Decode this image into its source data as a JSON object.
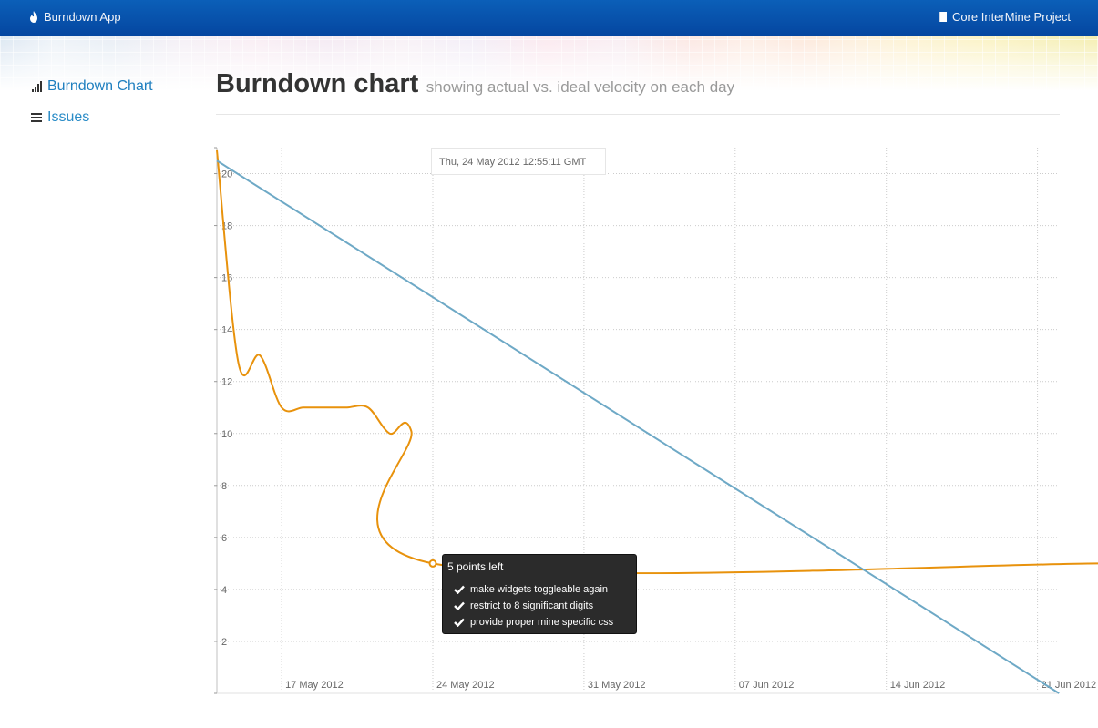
{
  "navbar": {
    "brand_label": "Burndown App",
    "brand_icon": "flame-icon",
    "project_label": "Core InterMine Project",
    "project_icon": "book-icon",
    "color": "#0546a0"
  },
  "sidebar": {
    "items": [
      {
        "label": "Burndown Chart",
        "icon": "bar-chart-icon",
        "active": true
      },
      {
        "label": "Issues",
        "icon": "list-icon",
        "active": false
      }
    ]
  },
  "header": {
    "title": "Burndown chart",
    "subtitle": "showing actual vs. ideal velocity on each day"
  },
  "hover_label": "Thu, 24 May 2012 12:55:11 GMT",
  "tooltip": {
    "title": "5 points left",
    "items": [
      "make widgets toggleable again",
      "restrict to 8 significant digits",
      "provide proper mine specific css"
    ]
  },
  "chart_data": {
    "type": "line",
    "title": "",
    "xlabel": "",
    "ylabel": "",
    "x_ticks": [
      "17 May 2012",
      "24 May 2012",
      "31 May 2012",
      "07 Jun 2012",
      "14 Jun 2012",
      "21 Jun 2012"
    ],
    "y_ticks": [
      2,
      4,
      6,
      8,
      10,
      12,
      14,
      16,
      18,
      20
    ],
    "ylim": [
      0,
      21
    ],
    "grid": true,
    "series": [
      {
        "color": "#e8920c",
        "points": [
          {
            "x": "2012-05-14",
            "y": 20.9
          },
          {
            "x": "2012-05-15",
            "y": 12.7
          },
          {
            "x": "2012-05-16",
            "y": 13.0
          },
          {
            "x": "2012-05-17",
            "y": 11.0
          },
          {
            "x": "2012-05-18",
            "y": 11.0
          },
          {
            "x": "2012-05-19",
            "y": 11.0
          },
          {
            "x": "2012-05-20",
            "y": 11.0
          },
          {
            "x": "2012-05-21",
            "y": 11.0
          },
          {
            "x": "2012-05-22",
            "y": 10.0
          },
          {
            "x": "2012-05-23",
            "y": 10.1
          },
          {
            "x": "2012-05-24",
            "y": 5.0
          },
          {
            "x": "2012-06-24",
            "y": 5.0
          }
        ]
      },
      {
        "color": "#6ea9c6",
        "points": [
          {
            "x": "2012-05-14",
            "y": 20.5
          },
          {
            "x": "2012-06-22",
            "y": 0
          }
        ]
      }
    ],
    "highlight": {
      "x": "2012-05-24",
      "y": 5.0
    }
  }
}
